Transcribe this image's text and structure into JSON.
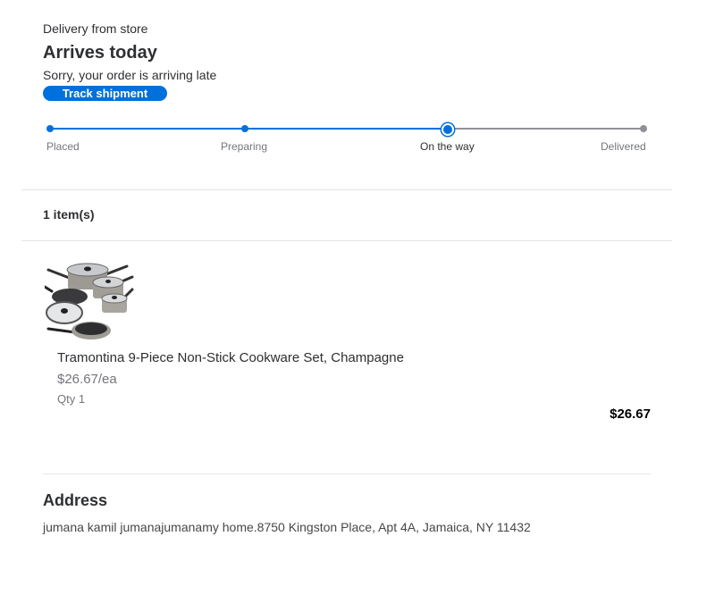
{
  "delivery": {
    "method": "Delivery from store",
    "title": "Arrives today",
    "status_message": "Sorry, your order is arriving late",
    "track_label": "Track shipment"
  },
  "tracker": {
    "steps": [
      "Placed",
      "Preparing",
      "On the way",
      "Delivered"
    ],
    "current_step_index": 2
  },
  "items": {
    "count_label": "1 item(s)",
    "list": [
      {
        "name": "Tramontina 9-Piece Non-Stick Cookware Set, Champagne",
        "unit_price": "$26.67/ea",
        "qty": "Qty 1",
        "total": "$26.67",
        "image_icon": "cookware-set-image"
      }
    ]
  },
  "address": {
    "title": "Address",
    "line": "jumana kamil jumanajumanamy home.8750 Kingston Place, Apt 4A, Jamaica, NY 11432"
  },
  "colors": {
    "accent": "#0071dc",
    "text": "#2e2f32",
    "muted": "#74767c",
    "inactive": "#909196",
    "divider": "#e3e4e5"
  }
}
